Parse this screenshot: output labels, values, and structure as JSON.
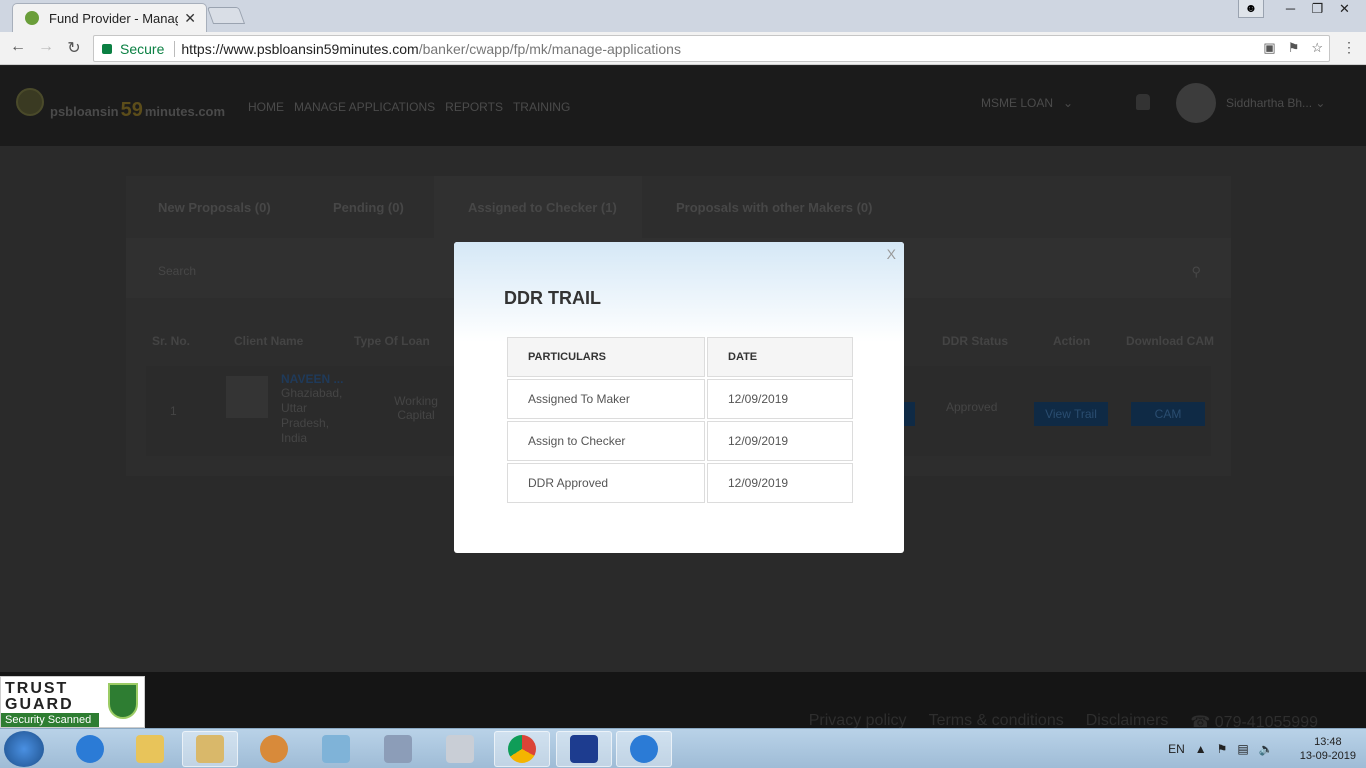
{
  "browser": {
    "tab_title": "Fund Provider - Manage",
    "tab_close": "✕",
    "secure_label": "Secure",
    "url_domain": "https://www.psbloansin59minutes.com",
    "url_path": "/banker/cwapp/fp/mk/manage-applications"
  },
  "site": {
    "logo_part1": "psbloansin",
    "logo_part2": "59",
    "logo_part3": "minutes.com",
    "nav": [
      "HOME",
      "MANAGE APPLICATIONS",
      "REPORTS",
      "TRAINING"
    ],
    "loan_selector": "MSME LOAN",
    "user_name": "Siddhartha Bh..."
  },
  "tabs": [
    "New Proposals (0)",
    "Pending (0)",
    "Assigned to Checker (1)",
    "Proposals with other Makers (0)"
  ],
  "search_placeholder": "Search",
  "table": {
    "headers": {
      "sr_no": "Sr. No.",
      "client_name": "Client Name",
      "type_of_loan": "Type Of Loan",
      "ddr_status": "DDR Status",
      "action": "Action",
      "download_cam": "Download CAM"
    },
    "row": {
      "sr_no": "1",
      "client_name": "NAVEEN ...",
      "client_location": "Ghaziabad, Uttar Pradesh, India",
      "type_of_loan": "Working Capital",
      "ddr_status": "Approved",
      "view_trail_button": "View Trail",
      "cam_button": "CAM"
    }
  },
  "footer_links": [
    "Privacy policy",
    "Terms & conditions",
    "Disclaimers",
    "079-41055999"
  ],
  "trustguard": {
    "title": "TRUST GUARD",
    "subtitle": "Security Scanned"
  },
  "modal": {
    "close": "X",
    "title": "DDR TRAIL",
    "col_particulars": "PARTICULARS",
    "col_date": "DATE",
    "rows": [
      {
        "particulars": "Assigned To Maker",
        "date": "12/09/2019"
      },
      {
        "particulars": "Assign to Checker",
        "date": "12/09/2019"
      },
      {
        "particulars": "DDR Approved",
        "date": "12/09/2019"
      }
    ]
  },
  "taskbar": {
    "language": "EN",
    "time": "13:48",
    "date": "13-09-2019"
  },
  "colors": {
    "modal_header_gradient": "#d5e8f6",
    "secure_green": "#0b8043"
  }
}
